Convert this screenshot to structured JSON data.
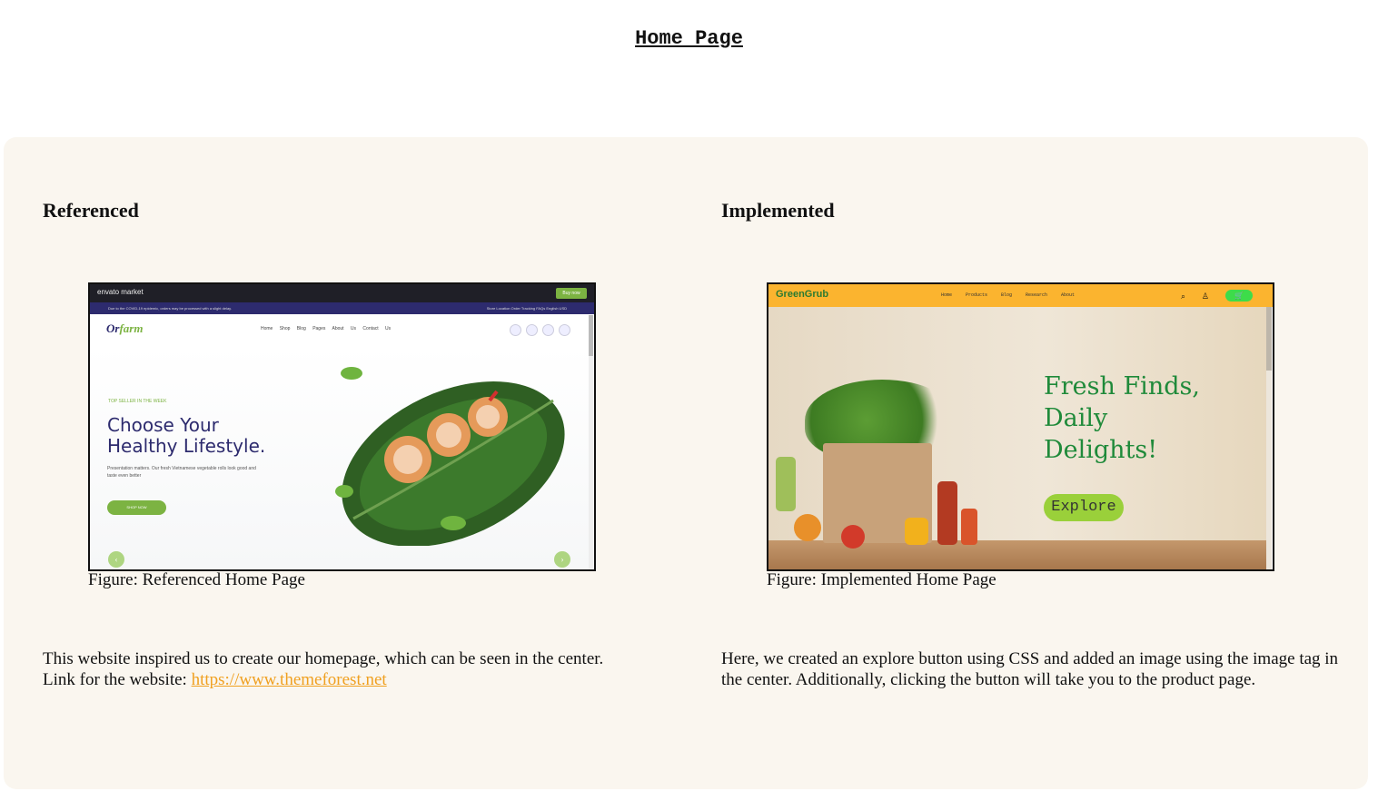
{
  "page": {
    "title": "Home  Page"
  },
  "referenced": {
    "heading": "Referenced",
    "caption": "Figure: Referenced Home Page",
    "description_line1": "This website inspired us to create our homepage, which can be seen in the center.",
    "description_prefix": "Link for the website: ",
    "link_text": "https://www.themeforest.net",
    "mock": {
      "market_logo": "envato market",
      "buy_label": "Buy now",
      "notice": "Due to the COVID-19 epidemic, orders may be processed with a slight delay.",
      "notice_right": "Store Location   Order Tracking   FAQs   English   USD",
      "brand": "farm",
      "menu": "Home  Shop  Blog  Pages  About Us  Contact Us",
      "kicker": "TOP SELLER IN THE WEEK",
      "headline_1": "Choose Your",
      "headline_2": "Healthy Lifestyle.",
      "paragraph": "Presentation matters. Our fresh Vietnamese vegetable rolls look good and taste even better",
      "cta": "SHOP NOW",
      "prev": "‹",
      "next": "›"
    }
  },
  "implemented": {
    "heading": "Implemented",
    "caption": "Figure: Implemented Home Page",
    "description": "Here, we created an explore button using CSS and added an image using the image tag in the center. Additionally, clicking the button will take you to the product page.",
    "mock": {
      "brand": "GreenGrub",
      "menu": "Home  Products  Blog  Research  About",
      "search_glyph": "⌕",
      "user_glyph": "♙",
      "cart_glyph": "🛒",
      "headline_1": "Fresh Finds,",
      "headline_2": "Daily",
      "headline_3": "Delights!",
      "explore": "Explore"
    }
  },
  "colors": {
    "panel_bg": "#faf6ef",
    "link": "#f0a020",
    "green": "#1f8a3a",
    "orange_bar": "#fbb42f"
  }
}
